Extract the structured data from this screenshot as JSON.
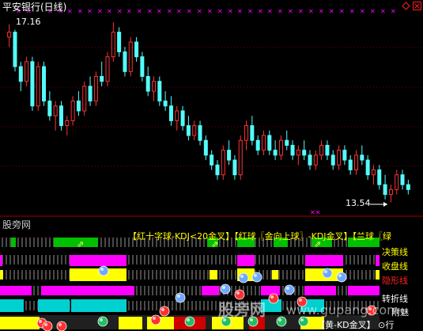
{
  "chart_title": "平安银行(日线)",
  "price_high_label": "17.16",
  "price_low_label": "13.54",
  "lower_pane_title": "股旁网",
  "legend": {
    "item1": "【红十字球-KDJ<20金叉】",
    "item2": "【红球〖金向上球〗-KDJ金叉】",
    "item3": "【兰球〖绿"
  },
  "side_labels": {
    "trend": "决策线",
    "close": "收盘线",
    "hidden": "隐形线",
    "turn": "转折线",
    "extra": "附魅"
  },
  "watermark": "股旁网",
  "watermark_url": "www.gupang.com",
  "footer_text": "【黄-KD金叉】 ⊙行",
  "colors": {
    "up": "#ff3232",
    "down": "#54fcfc",
    "magenta": "#ff00ff",
    "yellow": "#ffff00",
    "green": "#00c000",
    "cyan": "#00d0d0",
    "grid": "#a00000"
  },
  "icons": [
    "window-control-restore-icon",
    "window-control-close-icon"
  ],
  "chart_data": {
    "type": "candlestick",
    "title": "平安银行(日线)",
    "annotations": [
      {
        "label": "17.16",
        "kind": "high"
      },
      {
        "label": "13.54",
        "kind": "low"
      }
    ],
    "ohlc": [
      [
        16.9,
        17.16,
        16.7,
        17.0
      ],
      [
        17.0,
        17.05,
        16.2,
        16.3
      ],
      [
        16.3,
        16.4,
        15.8,
        16.0
      ],
      [
        16.0,
        16.5,
        15.9,
        16.4
      ],
      [
        16.4,
        16.5,
        15.4,
        15.5
      ],
      [
        15.5,
        16.4,
        15.4,
        16.3
      ],
      [
        16.3,
        16.4,
        15.5,
        15.6
      ],
      [
        15.6,
        15.8,
        15.2,
        15.3
      ],
      [
        15.3,
        15.6,
        15.0,
        15.5
      ],
      [
        15.5,
        15.6,
        15.0,
        15.1
      ],
      [
        15.1,
        15.3,
        14.9,
        15.2
      ],
      [
        15.2,
        15.7,
        15.1,
        15.6
      ],
      [
        15.6,
        15.8,
        15.3,
        15.4
      ],
      [
        15.4,
        16.0,
        15.3,
        15.9
      ],
      [
        15.9,
        16.1,
        15.5,
        15.6
      ],
      [
        15.6,
        16.2,
        15.5,
        16.1
      ],
      [
        16.1,
        16.4,
        15.9,
        16.0
      ],
      [
        16.0,
        16.6,
        15.9,
        16.5
      ],
      [
        16.5,
        17.2,
        16.4,
        17.0
      ],
      [
        17.0,
        17.1,
        16.5,
        16.6
      ],
      [
        16.6,
        16.7,
        16.1,
        16.2
      ],
      [
        16.2,
        16.9,
        16.1,
        16.8
      ],
      [
        16.8,
        16.9,
        16.4,
        16.5
      ],
      [
        16.5,
        16.6,
        16.0,
        16.1
      ],
      [
        16.1,
        16.3,
        15.7,
        15.8
      ],
      [
        15.8,
        16.1,
        15.6,
        16.0
      ],
      [
        16.0,
        16.1,
        15.5,
        15.6
      ],
      [
        15.6,
        15.8,
        15.4,
        15.5
      ],
      [
        15.5,
        15.7,
        15.1,
        15.2
      ],
      [
        15.2,
        15.5,
        15.0,
        15.4
      ],
      [
        15.4,
        15.5,
        15.0,
        15.1
      ],
      [
        15.1,
        15.3,
        14.8,
        14.9
      ],
      [
        14.9,
        15.2,
        14.8,
        15.1
      ],
      [
        15.1,
        15.2,
        14.7,
        14.8
      ],
      [
        14.8,
        14.9,
        14.4,
        14.5
      ],
      [
        14.5,
        14.6,
        14.2,
        14.3
      ],
      [
        14.3,
        14.4,
        14.0,
        14.1
      ],
      [
        14.1,
        14.7,
        14.0,
        14.6
      ],
      [
        14.6,
        14.8,
        14.3,
        14.4
      ],
      [
        14.4,
        14.5,
        14.0,
        14.1
      ],
      [
        14.1,
        14.9,
        14.0,
        14.8
      ],
      [
        14.8,
        15.2,
        14.6,
        15.1
      ],
      [
        15.1,
        15.3,
        14.7,
        14.8
      ],
      [
        14.8,
        14.9,
        14.5,
        14.6
      ],
      [
        14.6,
        15.0,
        14.5,
        14.9
      ],
      [
        14.9,
        15.0,
        14.5,
        14.6
      ],
      [
        14.6,
        14.8,
        14.4,
        14.5
      ],
      [
        14.5,
        14.9,
        14.4,
        14.8
      ],
      [
        14.8,
        15.0,
        14.6,
        14.7
      ],
      [
        14.7,
        14.8,
        14.4,
        14.5
      ],
      [
        14.5,
        14.7,
        14.3,
        14.6
      ],
      [
        14.6,
        14.8,
        14.4,
        14.5
      ],
      [
        14.5,
        14.6,
        14.2,
        14.3
      ],
      [
        14.3,
        14.6,
        14.2,
        14.5
      ],
      [
        14.5,
        14.8,
        14.4,
        14.7
      ],
      [
        14.7,
        14.8,
        14.4,
        14.5
      ],
      [
        14.5,
        14.6,
        14.2,
        14.3
      ],
      [
        14.3,
        14.7,
        14.2,
        14.6
      ],
      [
        14.6,
        14.7,
        14.3,
        14.4
      ],
      [
        14.4,
        14.5,
        14.1,
        14.2
      ],
      [
        14.2,
        14.6,
        14.1,
        14.5
      ],
      [
        14.5,
        14.7,
        14.3,
        14.4
      ],
      [
        14.4,
        14.5,
        14.0,
        14.1
      ],
      [
        14.1,
        14.3,
        13.9,
        14.2
      ],
      [
        14.2,
        14.3,
        13.8,
        13.9
      ],
      [
        13.9,
        14.1,
        13.6,
        13.7
      ],
      [
        13.7,
        13.9,
        13.54,
        13.8
      ],
      [
        13.8,
        14.2,
        13.7,
        14.1
      ],
      [
        14.1,
        14.2,
        13.8,
        13.9
      ],
      [
        13.9,
        14.0,
        13.7,
        13.8
      ]
    ]
  }
}
